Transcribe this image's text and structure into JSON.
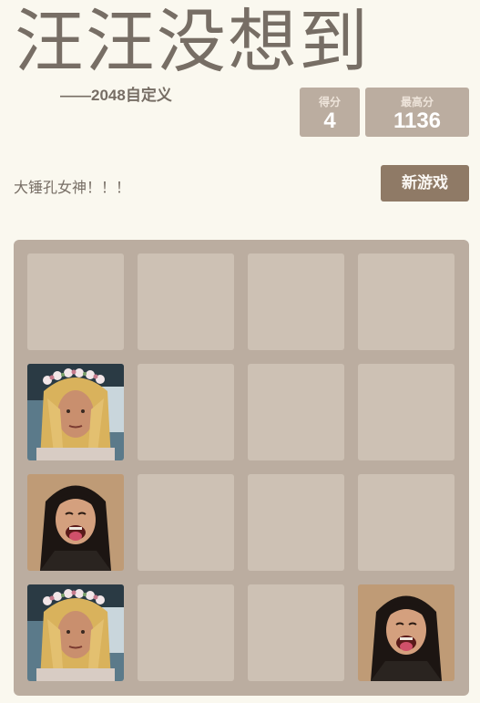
{
  "header": {
    "title": "汪汪没想到",
    "subtitle": "——2048自定义"
  },
  "scores": {
    "score_label": "得分",
    "score_value": "4",
    "best_label": "最高分",
    "best_value": "1136"
  },
  "tagline": "大锤孔女神！！！",
  "new_game_label": "新游戏",
  "board": {
    "size": 4,
    "rows": [
      [
        "",
        "",
        "",
        ""
      ],
      [
        "flower-crown-face",
        "",
        "",
        ""
      ],
      [
        "laughing-face",
        "",
        "",
        ""
      ],
      [
        "flower-crown-face",
        "",
        "",
        "laughing-face"
      ]
    ]
  },
  "colors": {
    "background": "#faf8ef",
    "board": "#bbada0",
    "empty_cell": "#cdc1b4",
    "button": "#8f7a66",
    "text": "#776e65"
  }
}
